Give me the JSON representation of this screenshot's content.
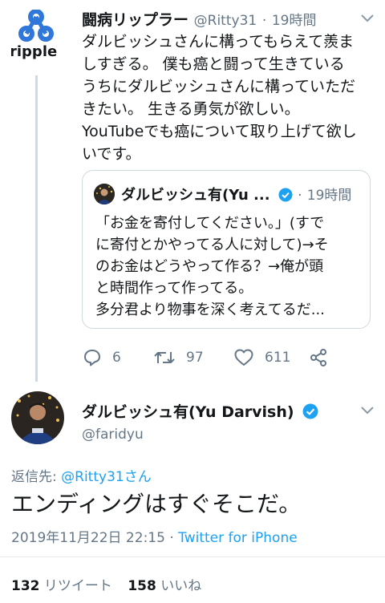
{
  "tweet": {
    "author_name": "闘病リップラー",
    "author_handle": "@Ritty31",
    "separator": "·",
    "time": "19時間",
    "avatar_text": "ripple",
    "body_lines": [
      "ダルビッシュさんに構ってもらえて羨ま",
      "しすぎる。 僕も癌と闘って生きている",
      "うちにダルビッシュさんに構っていただ",
      "きたい。 生きる勇気が欲しい。",
      "YouTubeでも癌について取り上げて欲し",
      "いです。"
    ],
    "quoted": {
      "author_name": "ダルビッシュ有(Yu ...",
      "separator": "·",
      "time": "19時間",
      "body_lines": [
        "「お金を寄付してください。」(すで",
        "に寄付とかやってる人に対して)→そ",
        "のお金はどうやって作る？→俺が頭",
        "と時間作って作ってる。",
        "多分君より物事を深く考えてるだ..."
      ]
    },
    "actions": {
      "replies": "6",
      "retweets": "97",
      "likes": "611"
    }
  },
  "reply": {
    "author_name": "ダルビッシュ有(Yu Darvish)",
    "author_handle": "@faridyu",
    "replying_label": "返信先: ",
    "replying_to": "@Ritty31さん",
    "text": "エンディングはすぐそこだ。",
    "timestamp": "2019年11月22日 22:15 · ",
    "client": "Twitter for iPhone",
    "retweet_count": "132",
    "retweet_label": " リツイート",
    "like_count": "158",
    "like_label": " いいね"
  },
  "colors": {
    "accent": "#1da1f2",
    "secondary_text": "#657786",
    "border": "#cfd9de",
    "ripple_blue": "#2f77d8"
  },
  "icons": [
    "ripple-logo-icon",
    "chevron-down-icon",
    "verified-badge-icon",
    "reply-icon",
    "retweet-icon",
    "like-icon",
    "share-icon"
  ]
}
